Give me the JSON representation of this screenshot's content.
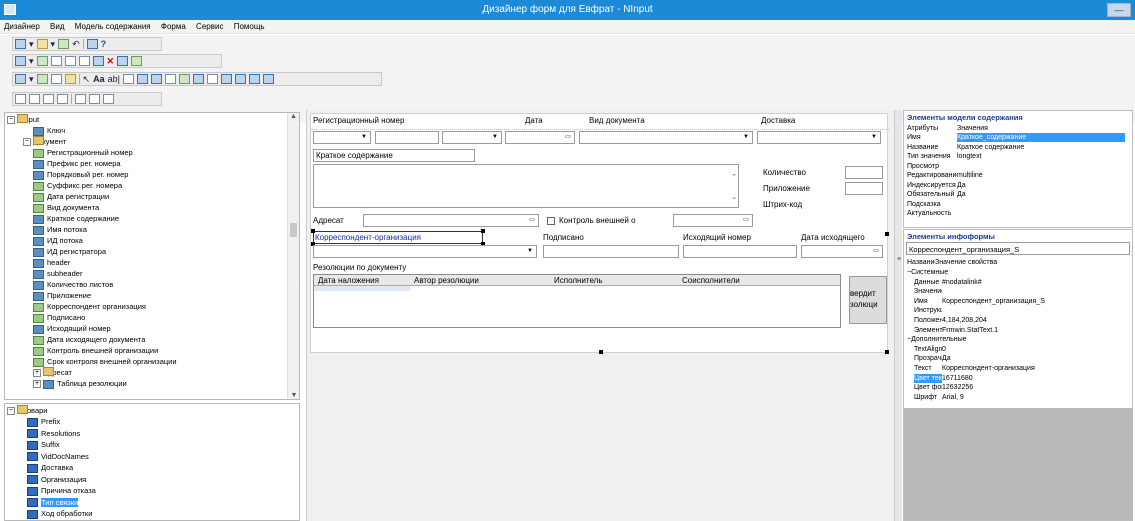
{
  "window": {
    "title": "Дизайнер форм для Евфрат - NInput",
    "min_label": "—"
  },
  "menu": [
    "Дизайнер",
    "Вид",
    "Модель содержания",
    "Форма",
    "Сервис",
    "Помощь"
  ],
  "tree": {
    "root": "NInput",
    "items": [
      {
        "label": "Ключ",
        "indent": 2,
        "icon": "blue"
      },
      {
        "label": "Документ",
        "indent": 1,
        "icon": "folder",
        "expander": "−"
      },
      {
        "label": "Регистрационный номер",
        "indent": 2,
        "icon": "green"
      },
      {
        "label": "Префикс рег. номера",
        "indent": 2,
        "icon": "blue"
      },
      {
        "label": "Порядковый рег. номер",
        "indent": 2,
        "icon": "blue"
      },
      {
        "label": "Суффикс рег. номера",
        "indent": 2,
        "icon": "green"
      },
      {
        "label": "Дата регистрации",
        "indent": 2,
        "icon": "green"
      },
      {
        "label": "Вид документа",
        "indent": 2,
        "icon": "green"
      },
      {
        "label": "Краткое содержание",
        "indent": 2,
        "icon": "blue"
      },
      {
        "label": "Имя потока",
        "indent": 2,
        "icon": "blue"
      },
      {
        "label": "ИД потока",
        "indent": 2,
        "icon": "blue"
      },
      {
        "label": "ИД регистратора",
        "indent": 2,
        "icon": "blue"
      },
      {
        "label": "header",
        "indent": 2,
        "icon": "blue"
      },
      {
        "label": "subheader",
        "indent": 2,
        "icon": "blue"
      },
      {
        "label": "Количество листов",
        "indent": 2,
        "icon": "blue"
      },
      {
        "label": "Приложение",
        "indent": 2,
        "icon": "blue"
      },
      {
        "label": "Корреспондент организация",
        "indent": 2,
        "icon": "green"
      },
      {
        "label": "Подписано",
        "indent": 2,
        "icon": "green"
      },
      {
        "label": "Исходящий номер",
        "indent": 2,
        "icon": "blue"
      },
      {
        "label": "Дата исходящего документа",
        "indent": 2,
        "icon": "green"
      },
      {
        "label": "Контроль внешней организации",
        "indent": 2,
        "icon": "green"
      },
      {
        "label": "Срок контроля внешней организации",
        "indent": 2,
        "icon": "green"
      },
      {
        "label": "Адресат",
        "indent": 2,
        "icon": "folder",
        "expander": "+"
      },
      {
        "label": "Таблица резолюции",
        "indent": 2,
        "icon": "blue",
        "expander": "+"
      }
    ]
  },
  "dictionaries": {
    "root": "Словари",
    "items": [
      "Prefix",
      "Resolutions",
      "Suffix",
      "VidDocNames",
      "Доставка",
      "Организация",
      "Причина отказа",
      "Тип связки",
      "Ход обработки"
    ],
    "selected": "Тип связки"
  },
  "form": {
    "labels": {
      "reg_number": "Регистрационный номер",
      "date": "Дата",
      "doc_type": "Вид документа",
      "delivery": "Доставка",
      "summary": "Краткое содержание",
      "quantity": "Количество",
      "attachment": "Приложение",
      "barcode": "Штрих-код",
      "addressee": "Адресат",
      "control": "Контроль внешней о",
      "correspondent": "Корреспондент-организация",
      "signed": "Подписано",
      "outgoing_number": "Исходящий номер",
      "outgoing_date": "Дата исходящего",
      "resolutions": "Резолюции по документу",
      "side_button_1": "вердит",
      "side_button_2": "золюци"
    },
    "resolution_columns": [
      "Дата наложения",
      "Автор резолюции",
      "Исполнитель",
      "Соисполнители"
    ]
  },
  "content_model": {
    "title": "Элементы модели содержания",
    "header": [
      "Атрибуты",
      "Значения"
    ],
    "rows": [
      {
        "k": "Имя",
        "v": "Краткое_содержание",
        "selected": true
      },
      {
        "k": "Название",
        "v": "Краткое содержание"
      },
      {
        "k": "Тип значения",
        "v": "longtext"
      },
      {
        "k": "Просмотр",
        "v": ""
      },
      {
        "k": "Редактирование",
        "v": "multiline"
      },
      {
        "k": "Индексируется",
        "v": "Да"
      },
      {
        "k": "Обязательный",
        "v": "Да"
      },
      {
        "k": "Подсказка",
        "v": ""
      },
      {
        "k": "Актуальность",
        "v": ""
      }
    ]
  },
  "infoform": {
    "title": "Элементы инфоформы",
    "selected_element": "Корреспондент_организация_S",
    "header": [
      "Название",
      "Значение свойства"
    ],
    "rows": [
      {
        "k": "Системные",
        "v": "",
        "group": true
      },
      {
        "k": "Данные",
        "v": "#nodatalink#"
      },
      {
        "k": "Значение",
        "v": ""
      },
      {
        "k": "Имя",
        "v": "Корреспондент_организация_S"
      },
      {
        "k": "Инструкция",
        "v": ""
      },
      {
        "k": "Положение",
        "v": "4,184,208,204"
      },
      {
        "k": "Элемент",
        "v": "Frmwin.StatText.1"
      },
      {
        "k": "Дополнительные",
        "v": "",
        "group": true
      },
      {
        "k": "TextAlign",
        "v": "0"
      },
      {
        "k": "Прозрачный",
        "v": "Да"
      },
      {
        "k": "Текст",
        "v": "Корреспондент-организация"
      },
      {
        "k": "Цвет текста",
        "v": "16711680",
        "selected": true
      },
      {
        "k": "Цвет фона",
        "v": "12632256"
      },
      {
        "k": "Шрифт",
        "v": "Arial, 9"
      }
    ]
  }
}
